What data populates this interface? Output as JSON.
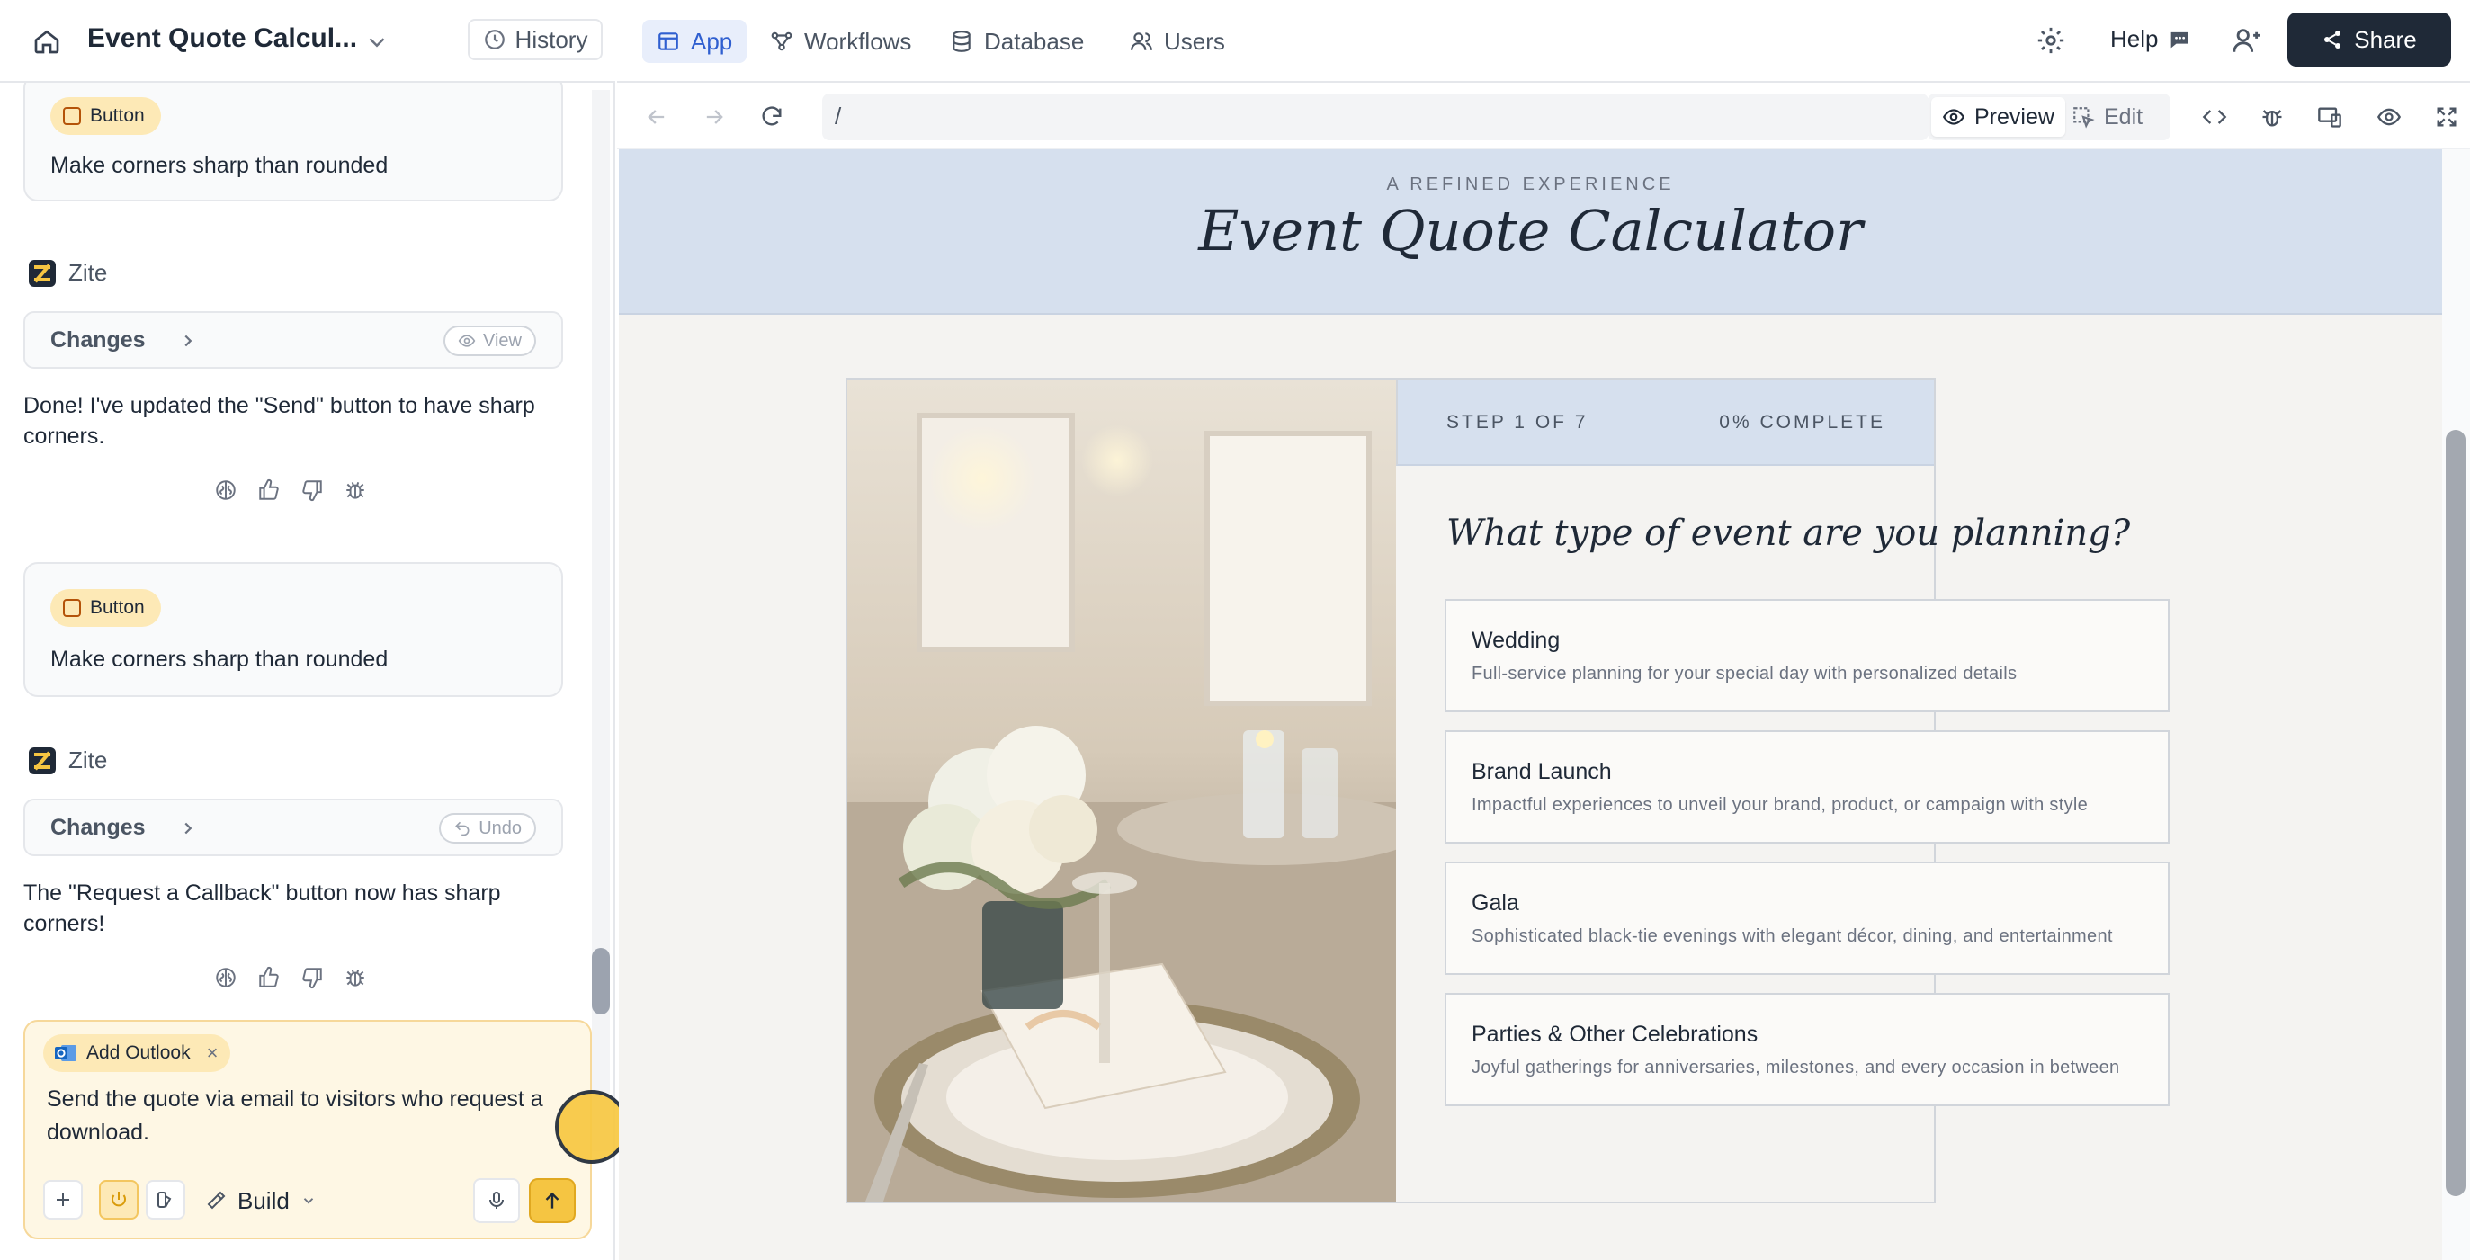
{
  "header": {
    "title": "Event Quote Calcul...",
    "history_label": "History"
  },
  "chat": {
    "messages": [
      {
        "chip": "Button",
        "text": "Make corners sharp than rounded"
      },
      {
        "author": "Zite",
        "changes_label": "Changes",
        "action": "View",
        "reply": "Done! I've updated the \"Send\" button to have sharp corners."
      },
      {
        "chip": "Button",
        "text": "Make corners sharp than rounded"
      },
      {
        "author": "Zite",
        "changes_label": "Changes",
        "action": "Undo",
        "reply": "The \"Request a Callback\" button now has sharp corners!"
      }
    ]
  },
  "composer": {
    "chip": "Add Outlook",
    "text": "Send the quote via email to visitors who request a download.",
    "mode_label": "Build"
  },
  "nav": {
    "tabs": [
      {
        "label": "App",
        "icon": "layout-icon",
        "active": true
      },
      {
        "label": "Workflows",
        "icon": "workflow-icon",
        "active": false
      },
      {
        "label": "Database",
        "icon": "database-icon",
        "active": false
      },
      {
        "label": "Users",
        "icon": "users-icon",
        "active": false
      }
    ],
    "help_label": "Help",
    "share_label": "Share"
  },
  "toolbar": {
    "url": "/",
    "preview_label": "Preview",
    "edit_label": "Edit"
  },
  "preview": {
    "eyebrow": "A REFINED EXPERIENCE",
    "title": "Event Quote Calculator",
    "step_text": "STEP 1 OF 7",
    "progress_text": "0% COMPLETE",
    "progress_fraction": 0,
    "question": "What type of event are you planning?",
    "options": [
      {
        "title": "Wedding",
        "desc": "Full-service planning for your special day with personalized details"
      },
      {
        "title": "Brand Launch",
        "desc": "Impactful experiences to unveil your brand, product, or campaign with style"
      },
      {
        "title": "Gala",
        "desc": "Sophisticated black-tie evenings with elegant décor, dining, and entertainment"
      },
      {
        "title": "Parties & Other Celebrations",
        "desc": "Joyful gatherings for anniversaries, milestones, and every occasion in between"
      }
    ]
  },
  "colors": {
    "accent": "#f5c542",
    "nav_active": "#2f5fd0",
    "hero_bg": "#d6e0ee",
    "share_bg": "#1f2937"
  }
}
